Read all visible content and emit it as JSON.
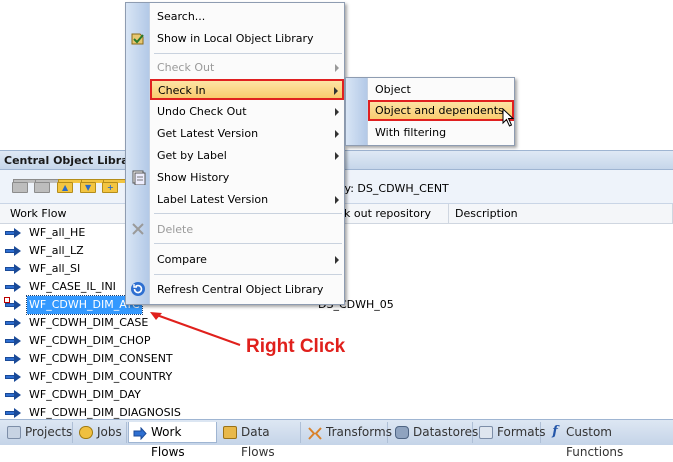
{
  "panel": {
    "title": "Central Object Library",
    "repository_label": "ry: DS_CDWH_CENT"
  },
  "columns": {
    "work_flow": "Work Flow",
    "checkout_repo": "k out repository",
    "description": "Description"
  },
  "rows": [
    {
      "name": "WF_all_HE",
      "repo": ""
    },
    {
      "name": "WF_all_LZ",
      "repo": ""
    },
    {
      "name": "WF_all_SI",
      "repo": ""
    },
    {
      "name": "WF_CASE_IL_INI",
      "repo": ""
    },
    {
      "name": "WF_CDWH_DIM_ATC",
      "repo": "DS_CDWH_05"
    },
    {
      "name": "WF_CDWH_DIM_CASE",
      "repo": ""
    },
    {
      "name": "WF_CDWH_DIM_CHOP",
      "repo": ""
    },
    {
      "name": "WF_CDWH_DIM_CONSENT",
      "repo": ""
    },
    {
      "name": "WF_CDWH_DIM_COUNTRY",
      "repo": ""
    },
    {
      "name": "WF_CDWH_DIM_DAY",
      "repo": ""
    },
    {
      "name": "WF_CDWH_DIM_DIAGNOSIS",
      "repo": ""
    }
  ],
  "context_menu": {
    "search": "Search...",
    "show_local": "Show in Local Object Library",
    "check_out": "Check Out",
    "check_in": "Check In",
    "undo_check_out": "Undo Check Out",
    "get_latest": "Get Latest Version",
    "get_by_label": "Get by Label",
    "show_history": "Show History",
    "label_latest": "Label Latest Version",
    "delete": "Delete",
    "compare": "Compare",
    "refresh": "Refresh Central Object Library"
  },
  "submenu": {
    "object": "Object",
    "object_and_dependents": "Object and dependents",
    "with_filtering": "With filtering"
  },
  "annotation": "Right Click",
  "tabs": [
    {
      "label": "Projects",
      "icon": "projects-icon"
    },
    {
      "label": "Jobs",
      "icon": "jobs-icon"
    },
    {
      "label": "Work Flows",
      "icon": "work-flows-icon"
    },
    {
      "label": "Data Flows",
      "icon": "data-flows-icon"
    },
    {
      "label": "Transforms",
      "icon": "transforms-icon"
    },
    {
      "label": "Datastores",
      "icon": "datastores-icon"
    },
    {
      "label": "Formats",
      "icon": "formats-icon"
    },
    {
      "label": "Custom Functions",
      "icon": "custom-functions-icon"
    }
  ],
  "colors": {
    "highlight": "#f9c96a",
    "red_box": "#e02020",
    "selection": "#3399ff"
  }
}
